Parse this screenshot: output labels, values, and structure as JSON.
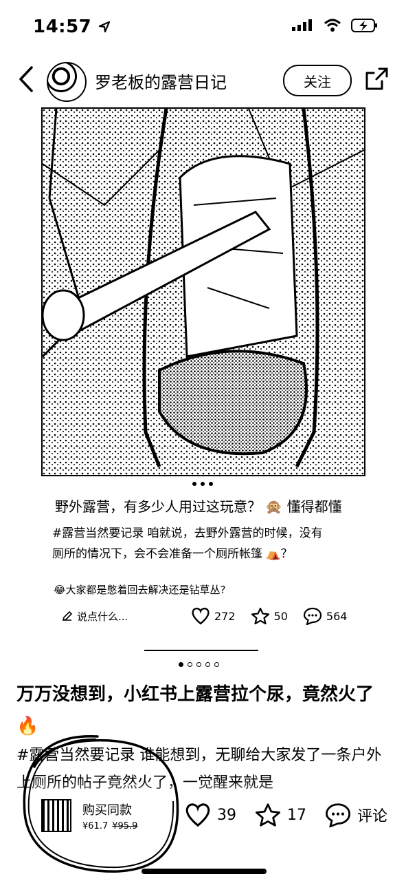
{
  "status": {
    "time": "14:57"
  },
  "header": {
    "author": "罗老板的露营日记",
    "follow_label": "关注"
  },
  "post": {
    "title": "野外露营，有多少人用过这玩意？",
    "title_tag": "懂得都懂",
    "tag": "#露营当然要记录",
    "body_part1": "咱就说，去野外露营的时候，没有",
    "body_part2": "厕所的情况下，会不会准备一个厕所帐篷",
    "body_end": "？",
    "question": "大家都是憋着回去解决还是钻草丛?"
  },
  "comment_bar": {
    "placeholder": "说点什么...",
    "likes": "272",
    "stars": "50",
    "comments": "564"
  },
  "feed": {
    "headline": "万万没想到，小红书上露营拉个尿，竟然火了",
    "body": "#露营当然要记录 谁能想到，无聊给大家发了一条户外上厕所的帖子竟然火了，一觉醒来就是"
  },
  "product": {
    "name": "购买同款",
    "price": "¥61.7",
    "old_price": "¥95.9"
  },
  "bottom": {
    "likes": "39",
    "stars": "17",
    "comment_label": "评论"
  },
  "colors": {
    "text": "#000000",
    "background": "#ffffff"
  }
}
